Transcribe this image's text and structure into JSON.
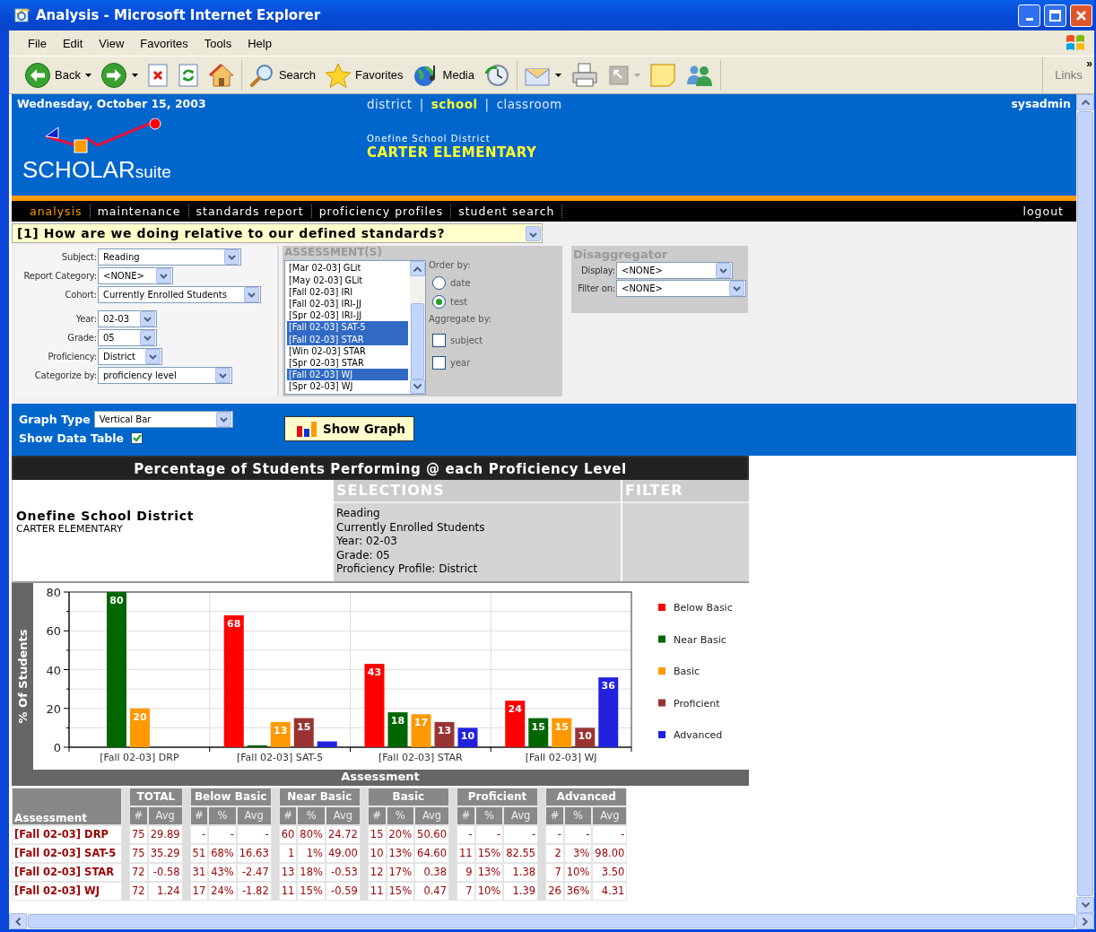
{
  "window": {
    "title": "Analysis - Microsoft Internet Explorer"
  },
  "menu": [
    "File",
    "Edit",
    "View",
    "Favorites",
    "Tools",
    "Help"
  ],
  "toolbar": {
    "groups": [
      {
        "items": [
          {
            "kind": "back",
            "label": "Back",
            "dropdown": true
          },
          {
            "kind": "forward",
            "dropdown": true
          },
          {
            "kind": "stop",
            "dropdown": false
          },
          {
            "kind": "refresh",
            "dropdown": false
          },
          {
            "kind": "home",
            "dropdown": false
          }
        ]
      },
      {
        "items": [
          {
            "kind": "search",
            "label": "Search",
            "dropdown": false
          },
          {
            "kind": "favorites",
            "label": "Favorites",
            "dropdown": false
          },
          {
            "kind": "media",
            "label": "Media",
            "dropdown": false
          },
          {
            "kind": "history",
            "dropdown": false
          }
        ]
      },
      {
        "items": [
          {
            "kind": "mail",
            "dropdown": true
          },
          {
            "kind": "print",
            "dropdown": false
          },
          {
            "kind": "edit",
            "dropdown": true
          },
          {
            "kind": "discuss",
            "dropdown": false
          },
          {
            "kind": "messenger",
            "dropdown": false
          }
        ]
      }
    ],
    "links": "Links",
    "more": "»"
  },
  "header": {
    "date": "Wednesday, October 15, 2003",
    "levels": [
      {
        "label": "district",
        "selected": false
      },
      {
        "label": "school",
        "selected": true
      },
      {
        "label": "classroom",
        "selected": false
      }
    ],
    "level_separator": "|",
    "user": "sysadmin",
    "logo": {
      "main": "SCHOLAR",
      "sub": "suite"
    },
    "district": "Onefine School District",
    "school": "CARTER ELEMENTARY"
  },
  "nav": {
    "items": [
      {
        "label": "analysis",
        "selected": true
      },
      {
        "label": "maintenance",
        "selected": false
      },
      {
        "label": "standards report",
        "selected": false
      },
      {
        "label": "proficiency profiles",
        "selected": false
      },
      {
        "label": "student search",
        "selected": false
      }
    ],
    "logout": "logout"
  },
  "question": {
    "value": "[1] How are we doing relative to our defined standards?"
  },
  "form": {
    "fields": [
      {
        "label": "Subject:",
        "value": "Reading"
      },
      {
        "label": "Report Category:",
        "value": "<NONE>"
      },
      {
        "label": "Cohort:",
        "value": "Currently Enrolled Students"
      },
      {
        "label": "Year:",
        "value": "02-03"
      },
      {
        "label": "Grade:",
        "value": "05"
      },
      {
        "label": "Proficiency:",
        "value": "District"
      },
      {
        "label": "Categorize by:",
        "value": "proficiency level"
      }
    ],
    "assessments": {
      "title": "ASSESSMENT(S)",
      "items": [
        {
          "label": "[Mar 02-03] GLit",
          "selected": false
        },
        {
          "label": "[May 02-03] GLit",
          "selected": false
        },
        {
          "label": "[Fall 02-03] IRI",
          "selected": false
        },
        {
          "label": "[Fall 02-03] IRI-JJ",
          "selected": false
        },
        {
          "label": "[Spr 02-03] IRI-JJ",
          "selected": false
        },
        {
          "label": "[Fall 02-03] SAT-5",
          "selected": true
        },
        {
          "label": "[Fall 02-03] STAR",
          "selected": true
        },
        {
          "label": "[Win 02-03] STAR",
          "selected": false
        },
        {
          "label": "[Spr 02-03] STAR",
          "selected": false
        },
        {
          "label": "[Fall 02-03] WJ",
          "selected": true
        },
        {
          "label": "[Spr 02-03] WJ",
          "selected": false
        }
      ]
    },
    "order_by": {
      "label": "Order by:",
      "options": [
        {
          "label": "date",
          "selected": false
        },
        {
          "label": "test",
          "selected": true
        }
      ]
    },
    "aggregate_by": {
      "label": "Aggregate by:",
      "options": [
        {
          "label": "subject",
          "checked": false
        },
        {
          "label": "year",
          "checked": false
        }
      ]
    },
    "disaggregator": {
      "title": "Disaggregator",
      "fields": [
        {
          "label": "Display:",
          "value": "<NONE>"
        },
        {
          "label": "Filter on:",
          "value": "<NONE>"
        }
      ]
    }
  },
  "graph_options": {
    "graph_type": {
      "label": "Graph Type",
      "value": "Vertical Bar"
    },
    "show_data_table": {
      "label": "Show Data Table",
      "checked": true
    },
    "show_graph": {
      "label": "Show Graph"
    }
  },
  "report": {
    "title": "Percentage of Students Performing @ each Proficiency Level",
    "district": "Onefine School District",
    "school": "CARTER ELEMENTARY",
    "selections": {
      "title": "SELECTIONS",
      "lines": [
        "Reading",
        "Currently Enrolled Students",
        "Year: 02-03",
        "Grade: 05",
        "Proficiency Profile: District"
      ]
    },
    "filter": {
      "title": "FILTER"
    },
    "chart_data": {
      "type": "bar",
      "xlabel": "Assessment",
      "ylabel": "% Of Students",
      "categories": [
        "[Fall 02-03] DRP",
        "[Fall 02-03] SAT-5",
        "[Fall 02-03] STAR",
        "[Fall 02-03] WJ"
      ],
      "series": [
        {
          "name": "Below Basic",
          "color": "#ff0000",
          "values": [
            null,
            68,
            43,
            24
          ],
          "value_labels": [
            null,
            "68",
            "43",
            "24"
          ]
        },
        {
          "name": "Near Basic",
          "color": "#006600",
          "values": [
            80,
            1,
            18,
            15
          ],
          "value_labels": [
            "80",
            null,
            "18",
            "15"
          ]
        },
        {
          "name": "Basic",
          "color": "#ff9900",
          "values": [
            20,
            13,
            17,
            15
          ],
          "value_labels": [
            "20",
            "13",
            "17",
            "15"
          ]
        },
        {
          "name": "Proficient",
          "color": "#993333",
          "values": [
            null,
            15,
            13,
            10
          ],
          "value_labels": [
            null,
            "15",
            "13",
            "10"
          ]
        },
        {
          "name": "Advanced",
          "color": "#2222dd",
          "values": [
            null,
            3,
            10,
            36
          ],
          "value_labels": [
            null,
            null,
            "10",
            "36"
          ]
        }
      ],
      "ylim": [
        0,
        80
      ],
      "yticks": [
        0,
        20,
        40,
        60,
        80
      ],
      "grid": true,
      "legend": true
    },
    "table": {
      "row_header": "Assessment",
      "groups": [
        {
          "title": "TOTAL",
          "columns": [
            "#",
            "Avg"
          ]
        },
        {
          "title": "Below Basic",
          "columns": [
            "#",
            "%",
            "Avg"
          ]
        },
        {
          "title": "Near Basic",
          "columns": [
            "#",
            "%",
            "Avg"
          ]
        },
        {
          "title": "Basic",
          "columns": [
            "#",
            "%",
            "Avg"
          ]
        },
        {
          "title": "Proficient",
          "columns": [
            "#",
            "%",
            "Avg"
          ]
        },
        {
          "title": "Advanced",
          "columns": [
            "#",
            "%",
            "Avg"
          ]
        }
      ],
      "rows": [
        {
          "label": "[Fall 02-03] DRP",
          "cells": [
            [
              "75",
              "29.89"
            ],
            [
              "-",
              "-",
              "-"
            ],
            [
              "60",
              "80%",
              "24.72"
            ],
            [
              "15",
              "20%",
              "50.60"
            ],
            [
              "-",
              "-",
              "-"
            ],
            [
              "-",
              "-",
              "-"
            ]
          ]
        },
        {
          "label": "[Fall 02-03] SAT-5",
          "cells": [
            [
              "75",
              "35.29"
            ],
            [
              "51",
              "68%",
              "16.63"
            ],
            [
              "1",
              "1%",
              "49.00"
            ],
            [
              "10",
              "13%",
              "64.60"
            ],
            [
              "11",
              "15%",
              "82.55"
            ],
            [
              "2",
              "3%",
              "98.00"
            ]
          ]
        },
        {
          "label": "[Fall 02-03] STAR",
          "cells": [
            [
              "72",
              "-0.58"
            ],
            [
              "31",
              "43%",
              "-2.47"
            ],
            [
              "13",
              "18%",
              "-0.53"
            ],
            [
              "12",
              "17%",
              "0.38"
            ],
            [
              "9",
              "13%",
              "1.38"
            ],
            [
              "7",
              "10%",
              "3.50"
            ]
          ]
        },
        {
          "label": "[Fall 02-03] WJ",
          "cells": [
            [
              "72",
              "1.24"
            ],
            [
              "17",
              "24%",
              "-1.82"
            ],
            [
              "11",
              "15%",
              "-0.59"
            ],
            [
              "11",
              "15%",
              "0.47"
            ],
            [
              "7",
              "10%",
              "1.39"
            ],
            [
              "26",
              "36%",
              "4.31"
            ]
          ]
        }
      ]
    }
  }
}
